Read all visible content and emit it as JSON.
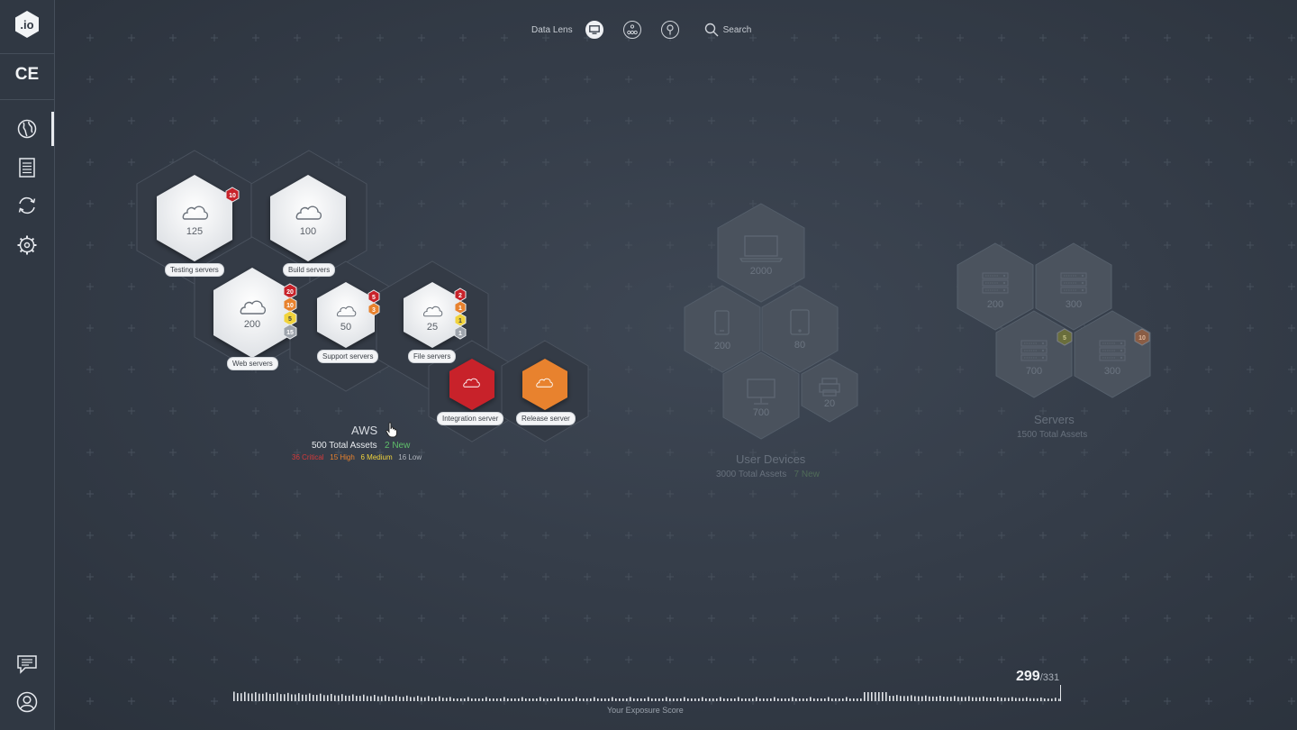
{
  "brand": {
    "logo_text": ".io",
    "edition": "CE"
  },
  "topbar": {
    "data_lens_label": "Data Lens",
    "search_label": "Search"
  },
  "aws": {
    "title": "AWS",
    "total_assets": "500 Total Assets",
    "new_count": "2 New",
    "critical": "36 Critical",
    "high": "15 High",
    "medium": "6 Medium",
    "low": "16 Low",
    "nodes": [
      {
        "label": "Testing servers",
        "count": "125",
        "badges": [
          "10"
        ]
      },
      {
        "label": "Build servers",
        "count": "100",
        "badges": []
      },
      {
        "label": "Web servers",
        "count": "200",
        "badges": [
          "20",
          "10",
          "5",
          "15"
        ]
      },
      {
        "label": "Support servers",
        "count": "50",
        "badges": [
          "5",
          "3"
        ]
      },
      {
        "label": "File servers",
        "count": "25",
        "badges": [
          "2",
          "1",
          "1",
          "1"
        ]
      },
      {
        "label": "Integration server"
      },
      {
        "label": "Release server"
      }
    ]
  },
  "user_devices": {
    "title": "User Devices",
    "total_assets": "3000 Total Assets",
    "new_count": "7 New",
    "nodes": [
      {
        "icon": "laptop-icon",
        "count": "2000"
      },
      {
        "icon": "phone-icon",
        "count": "200"
      },
      {
        "icon": "tablet-icon",
        "count": "80"
      },
      {
        "icon": "desktop-icon",
        "count": "700"
      },
      {
        "icon": "printer-icon",
        "count": "20"
      }
    ]
  },
  "servers": {
    "title": "Servers",
    "total_assets": "1500 Total Assets",
    "nodes": [
      {
        "count": "200"
      },
      {
        "count": "300"
      },
      {
        "count": "700",
        "badge": "5"
      },
      {
        "count": "300",
        "badge": "10"
      }
    ]
  },
  "exposure": {
    "score": "299",
    "total": "/331",
    "label": "Your Exposure Score"
  },
  "colors": {
    "critical": "#c8222a",
    "high": "#e8822e",
    "medium": "#f1d33c",
    "low": "#9ea4ac",
    "new": "#5fbf6a"
  }
}
